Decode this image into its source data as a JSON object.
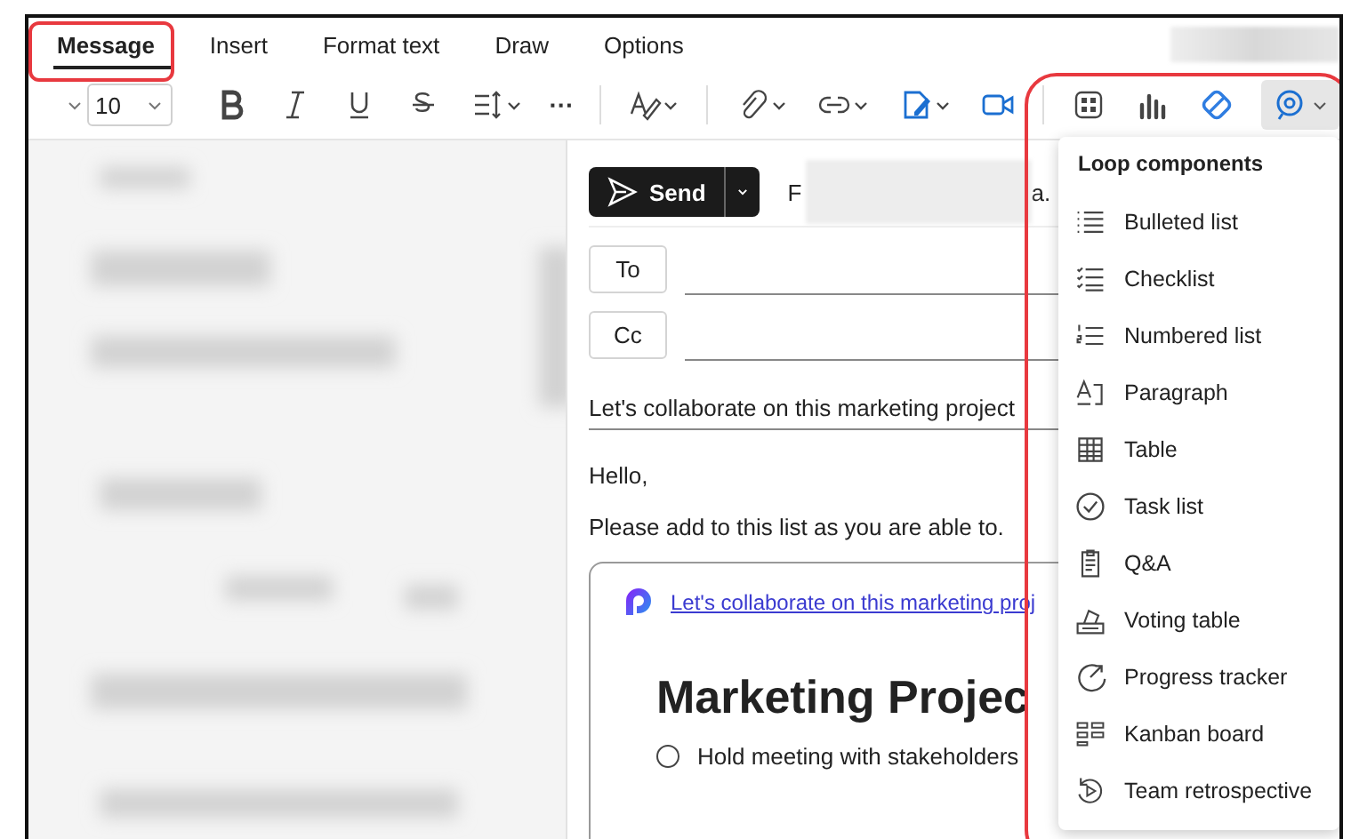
{
  "tabs": [
    {
      "label": "Message",
      "selected": true
    },
    {
      "label": "Insert",
      "selected": false
    },
    {
      "label": "Format text",
      "selected": false
    },
    {
      "label": "Draw",
      "selected": false
    },
    {
      "label": "Options",
      "selected": false
    }
  ],
  "toolbar": {
    "font_size": "10",
    "more": "···",
    "loop_button_pressed": true
  },
  "compose": {
    "send": "Send",
    "from_prefix": "F",
    "from_suffix": "a.",
    "to": "To",
    "cc": "Cc",
    "subject": "Let's collaborate on this marketing project",
    "body": [
      "Hello,",
      "Please add to this list as you are able to."
    ],
    "loop_card": {
      "link": "Let's collaborate on this marketing proj",
      "heading": "Marketing Projec",
      "tasks": [
        {
          "text": "Hold meeting with stakeholders",
          "checked": false
        }
      ]
    }
  },
  "menu": {
    "title": "Loop components",
    "items": [
      {
        "label": "Bulleted list"
      },
      {
        "label": "Checklist"
      },
      {
        "label": "Numbered list"
      },
      {
        "label": "Paragraph"
      },
      {
        "label": "Table"
      },
      {
        "label": "Task list"
      },
      {
        "label": "Q&A"
      },
      {
        "label": "Voting table"
      },
      {
        "label": "Progress tracker"
      },
      {
        "label": "Kanban board"
      },
      {
        "label": "Team retrospective"
      }
    ]
  }
}
